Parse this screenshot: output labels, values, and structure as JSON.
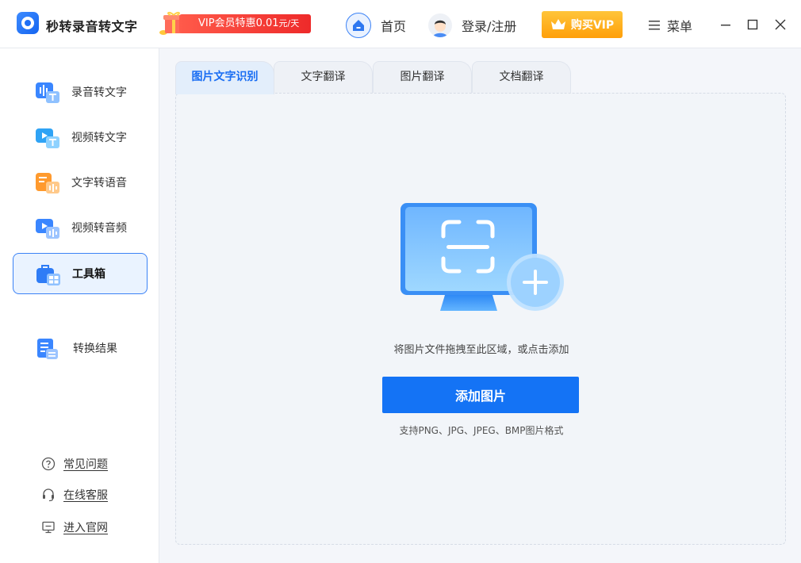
{
  "app": {
    "title": "秒转录音转文字"
  },
  "promo": {
    "text": "VIP会员特惠0.01",
    "unit": "元/天"
  },
  "nav": {
    "home": "首页",
    "login": "登录/注册",
    "vip": "购买VIP",
    "menu": "菜单"
  },
  "sidebar": {
    "items": [
      {
        "label": "录音转文字",
        "icon": "audio-to-text-icon"
      },
      {
        "label": "视频转文字",
        "icon": "video-to-text-icon"
      },
      {
        "label": "文字转语音",
        "icon": "text-to-speech-icon"
      },
      {
        "label": "视频转音频",
        "icon": "video-to-audio-icon"
      },
      {
        "label": "工具箱",
        "icon": "toolbox-icon",
        "active": true
      },
      {
        "label": "转换结果",
        "icon": "results-icon"
      }
    ],
    "help": [
      {
        "label": "常见问题",
        "icon": "question-icon"
      },
      {
        "label": "在线客服",
        "icon": "headset-icon"
      },
      {
        "label": "进入官网",
        "icon": "monitor-icon"
      }
    ]
  },
  "tabs": [
    {
      "label": "图片文字识别",
      "active": true
    },
    {
      "label": "文字翻译"
    },
    {
      "label": "图片翻译"
    },
    {
      "label": "文档翻译"
    }
  ],
  "main": {
    "drop_hint": "将图片文件拖拽至此区域，或点击添加",
    "add_button": "添加图片",
    "formats": "支持PNG、JPG、JPEG、BMP图片格式"
  },
  "colors": {
    "accent": "#1473f5",
    "vip": "#ffb020",
    "promo": "#f03a2e",
    "active_bg": "#eaf3ff"
  }
}
